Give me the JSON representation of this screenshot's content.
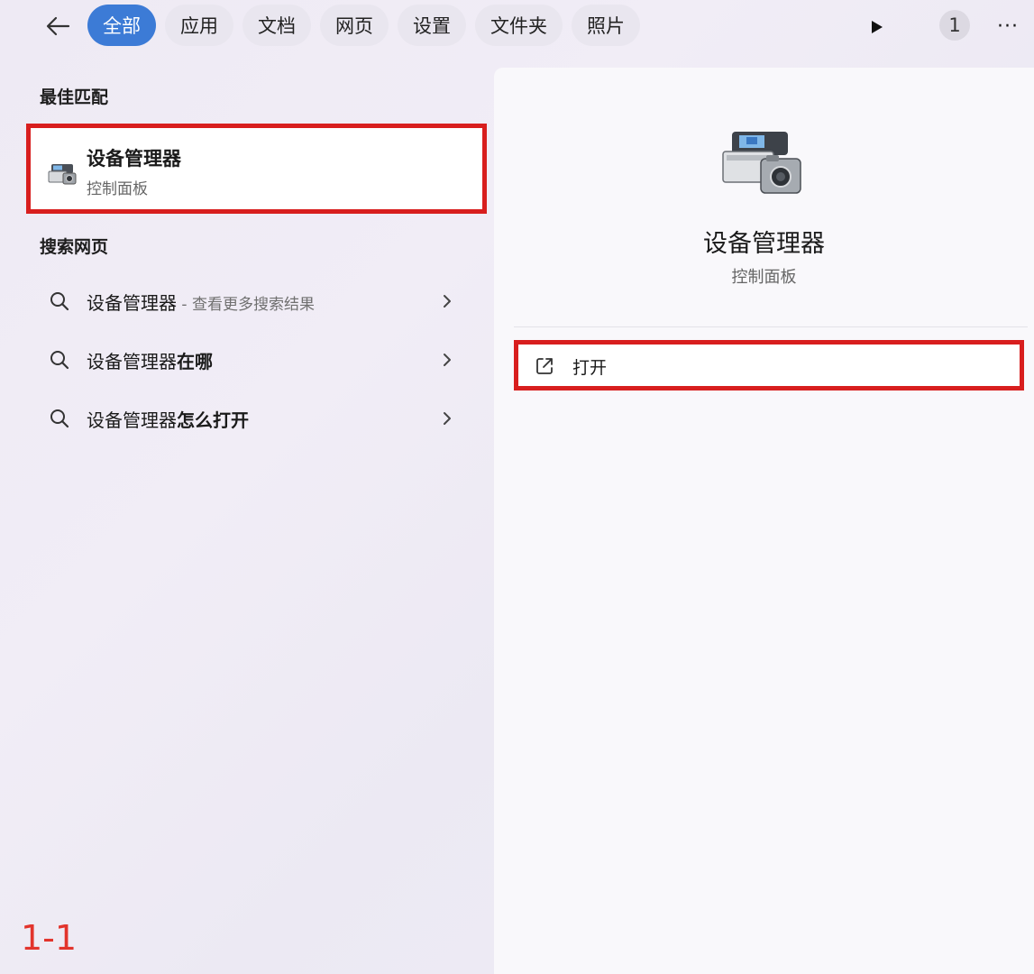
{
  "tabs": [
    {
      "label": "全部",
      "active": true
    },
    {
      "label": "应用",
      "active": false
    },
    {
      "label": "文档",
      "active": false
    },
    {
      "label": "网页",
      "active": false
    },
    {
      "label": "设置",
      "active": false
    },
    {
      "label": "文件夹",
      "active": false
    },
    {
      "label": "照片",
      "active": false
    }
  ],
  "topbar": {
    "count_badge": "1",
    "more_label": "···"
  },
  "best_match": {
    "section_title": "最佳匹配",
    "name": "设备管理器",
    "subtitle": "控制面板",
    "icon": "device-manager-icon"
  },
  "web_search": {
    "section_title": "搜索网页",
    "items": [
      {
        "query": "设备管理器",
        "suffix_bold": "",
        "extra": " - 查看更多搜索结果"
      },
      {
        "query": "设备管理器",
        "suffix_bold": "在哪",
        "extra": ""
      },
      {
        "query": "设备管理器",
        "suffix_bold": "怎么打开",
        "extra": ""
      }
    ]
  },
  "detail_panel": {
    "app_name": "设备管理器",
    "app_subtitle": "控制面板",
    "actions": [
      {
        "label": "打开",
        "icon": "open-external-icon"
      }
    ]
  },
  "watermark": "1-1",
  "colors": {
    "accent": "#3c7bd6",
    "highlight_border": "#d81e1e",
    "watermark": "#e2342c"
  }
}
